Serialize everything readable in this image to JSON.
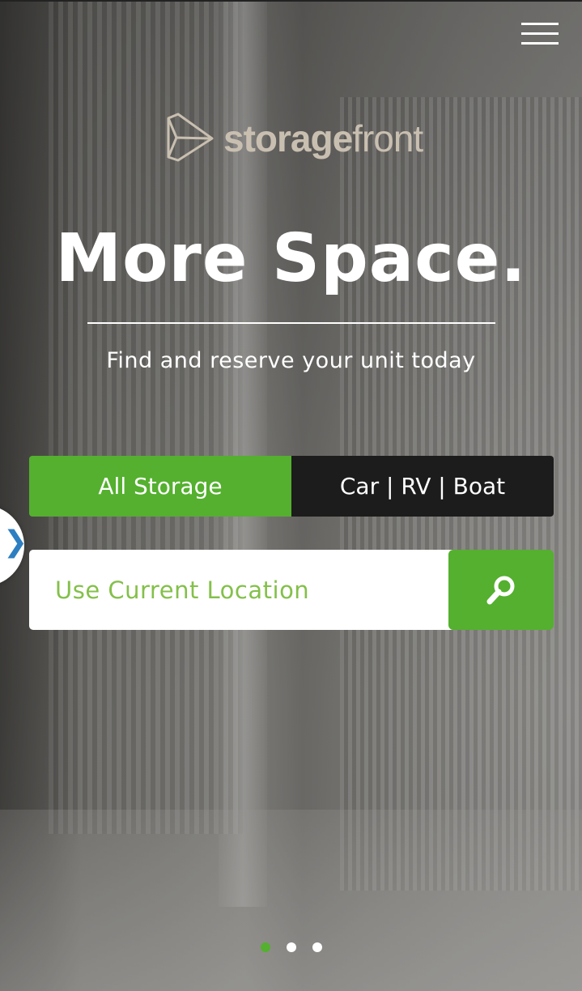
{
  "header": {
    "menu_icon": "hamburger-menu-icon"
  },
  "logo": {
    "icon": "storagefront-logo-mark",
    "word_bold": "storage",
    "word_light": "front",
    "color": "#c9bfb0"
  },
  "hero": {
    "headline": "More Space.",
    "subheadline": "Find and reserve your unit today"
  },
  "tabs": [
    {
      "label": "All Storage",
      "active": true
    },
    {
      "label": "Car | RV | Boat",
      "active": false
    }
  ],
  "search": {
    "placeholder": "Use Current Location",
    "button_icon": "search-magnifier-icon"
  },
  "side_tab": {
    "icon": "chevron-right-icon",
    "glyph": "❯"
  },
  "carousel": {
    "slides": 3,
    "active_index": 0
  },
  "colors": {
    "brand_green": "#54b02e",
    "placeholder_green": "#84c04a",
    "dark_tab": "#1c1c1c",
    "chevron_blue": "#2d7fc1"
  }
}
